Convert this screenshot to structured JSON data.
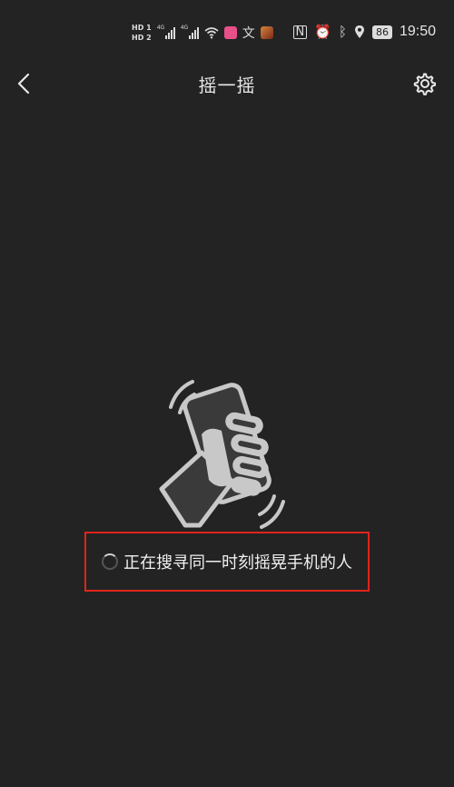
{
  "status_bar": {
    "hd1": "HD",
    "hd1_num": "1",
    "hd2": "HD",
    "hd2_num": "2",
    "network1": "4G",
    "network2": "4G",
    "battery": "86",
    "time": "19:50"
  },
  "header": {
    "title": "摇一摇",
    "back_icon": "chevron-left-icon",
    "settings_icon": "gear-icon"
  },
  "main": {
    "illustration": "hand-shaking-phone-icon",
    "status_text": "正在搜寻同一时刻摇晃手机的人"
  },
  "colors": {
    "background": "#232323",
    "highlight_border": "#e0241b",
    "illustration": "#c8c8c8"
  }
}
